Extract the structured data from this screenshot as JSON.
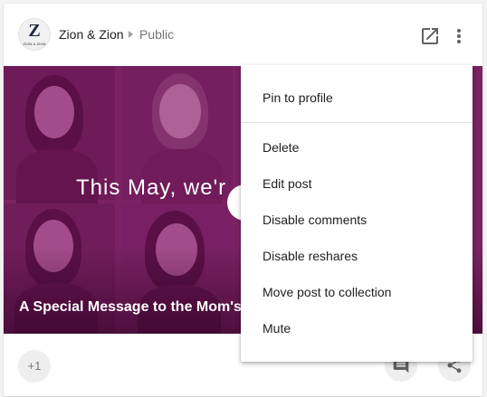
{
  "post": {
    "author": "Zion & Zion",
    "visibility": "Public",
    "avatar_letter": "Z",
    "avatar_subtext": "ZION & ZION"
  },
  "media": {
    "headline": "This May, we'r",
    "caption": "A Special Message to the Mom's o"
  },
  "actions": {
    "plus_one": "+1"
  },
  "icons": {
    "open": "open-in-new-icon",
    "more": "more-vert-icon",
    "comment": "comment-icon",
    "share": "share-icon"
  },
  "menu": {
    "items": [
      "Pin to profile",
      "Delete",
      "Edit post",
      "Disable comments",
      "Disable reshares",
      "Move post to collection",
      "Mute"
    ]
  },
  "colors": {
    "media_tint": "#7b2a66",
    "menu_bg": "#ffffff",
    "text_primary": "#212121",
    "text_secondary": "#757575"
  }
}
